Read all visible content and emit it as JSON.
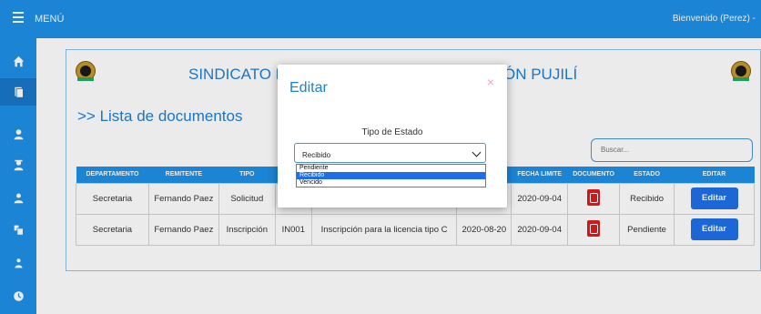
{
  "topbar": {
    "menu_label": "MENÚ",
    "welcome": "Bienvenido (Perez) -"
  },
  "sidebar": {
    "items": [
      "home-icon",
      "document-icon",
      "user-icon",
      "user-tie-icon",
      "user-group-icon",
      "users-icon",
      "sitemap-icon",
      "clock-icon"
    ]
  },
  "header": {
    "org_title_left": "SINDICATO DE C",
    "org_title_right": "ÓN PUJILÍ"
  },
  "main": {
    "list_title": ">> Lista de documentos",
    "search_placeholder": "Buscar...",
    "columns": [
      "DEPARTAMENTO",
      "REMITENTE",
      "TIPO",
      "C",
      "",
      "",
      "FECHA LIMITE",
      "DOCUMENTO",
      "ESTADO",
      "EDITAR"
    ],
    "rows": [
      {
        "departamento": "Secretaria",
        "remitente": "Fernando Paez",
        "tipo": "Solicitud",
        "codigo": "S",
        "descripcion": "",
        "fecha": "",
        "limite": "2020-09-04",
        "estado": "Recibido",
        "editar": "Editar"
      },
      {
        "departamento": "Secretaria",
        "remitente": "Fernando Paez",
        "tipo": "Inscripción",
        "codigo": "IN001",
        "descripcion": "Inscripción para la licencia tipo C",
        "fecha": "2020-08-20",
        "limite": "2020-09-04",
        "estado": "Pendiente",
        "editar": "Editar"
      }
    ]
  },
  "modal": {
    "title": "Editar",
    "close": "×",
    "field_label": "Tipo de Estado",
    "selected": "Recibido",
    "options": [
      "Pendiente",
      "Recibido",
      "Vencido"
    ]
  },
  "colors": {
    "primary": "#1f90e6",
    "button": "#1f6fe8",
    "pdf": "#e31b1b"
  }
}
